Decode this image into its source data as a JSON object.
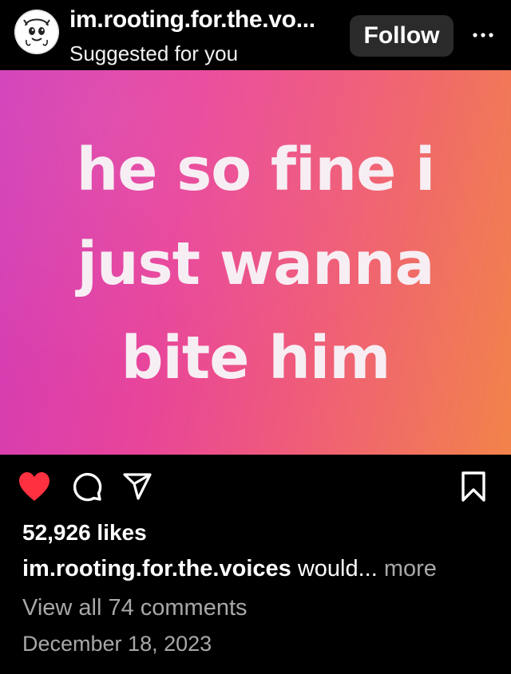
{
  "header": {
    "username": "im.rooting.for.the.vo...",
    "subtitle": "Suggested for you",
    "follow_label": "Follow",
    "more_icon": "more-horizontal-icon"
  },
  "post": {
    "image_lines": [
      "he so fine i",
      "just wanna",
      "bite him"
    ],
    "gradient_colors": [
      "#d13bb8",
      "#e8449a",
      "#ef5a7c",
      "#f2834a"
    ]
  },
  "actions": {
    "like_icon": "heart-filled-icon",
    "like_color": "#ff3040",
    "comment_icon": "comment-icon",
    "share_icon": "share-icon",
    "save_icon": "bookmark-icon"
  },
  "stats": {
    "likes_text": "52,926 likes"
  },
  "caption": {
    "username": "im.rooting.for.the.voices",
    "text": " would...",
    "more_label": " more"
  },
  "comments": {
    "view_all_text": "View all 74 comments"
  },
  "date": "December 18, 2023"
}
